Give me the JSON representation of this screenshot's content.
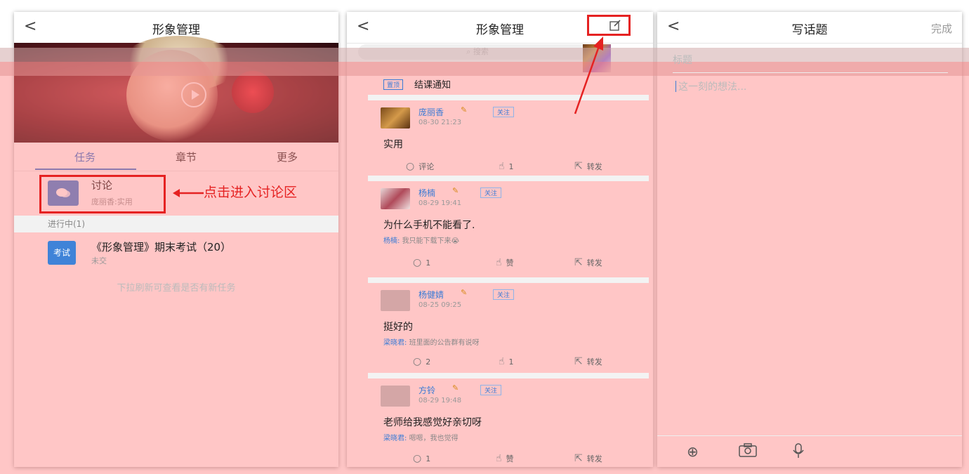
{
  "panel1": {
    "nav": {
      "back": "<",
      "title": "形象管理"
    },
    "tabs": [
      "任务",
      "章节",
      "更多"
    ],
    "discussion": {
      "icon": "chat-icon",
      "title": "讨论",
      "sub": "庞丽香:实用"
    },
    "callout": "点击进入讨论区",
    "section": "进行中(1)",
    "exam": {
      "badge": "考试",
      "title": "《形象管理》期末考试（20）",
      "sub": "未交"
    },
    "hint": "下拉刷新可查看是否有新任务"
  },
  "panel2": {
    "nav": {
      "back": "<",
      "title": "形象管理"
    },
    "search_placeholder": "搜索",
    "notice": {
      "badge": "置顶",
      "text": "结课通知"
    },
    "posts": [
      {
        "name": "庞丽香",
        "follow": "关注",
        "time": "08-30 21:23",
        "content": "实用",
        "reply_name": "",
        "reply_text": "",
        "comments": "评论",
        "likes": "1",
        "share": "转发"
      },
      {
        "name": "杨楠",
        "follow": "关注",
        "time": "08-29 19:41",
        "content": "为什么手机不能看了.",
        "reply_name": "杨楠:",
        "reply_text": "我只能下载下来😭",
        "comments": "1",
        "likes": "赞",
        "share": "转发"
      },
      {
        "name": "杨健婧",
        "follow": "关注",
        "time": "08-25 09:25",
        "content": "挺好的",
        "reply_name": "梁晓君:",
        "reply_text": "班里面的公告群有说呀",
        "comments": "2",
        "likes": "1",
        "share": "转发"
      },
      {
        "name": "方铃",
        "follow": "关注",
        "time": "08-29 19:48",
        "content": "老师给我感觉好亲切呀",
        "reply_name": "梁晓君:",
        "reply_text": "嗯嗯，我也觉得",
        "comments": "1",
        "likes": "赞",
        "share": "转发"
      }
    ]
  },
  "panel3": {
    "nav": {
      "back": "<",
      "title": "写话题",
      "done": "完成"
    },
    "title_placeholder": "标题",
    "body_placeholder": "这一刻的想法...",
    "toolbar_icons": [
      "plus-icon",
      "camera-icon",
      "microphone-icon"
    ]
  },
  "colors": {
    "accent": "#3a7bd5",
    "highlight": "#e52222",
    "overlay": "#ff7878"
  }
}
